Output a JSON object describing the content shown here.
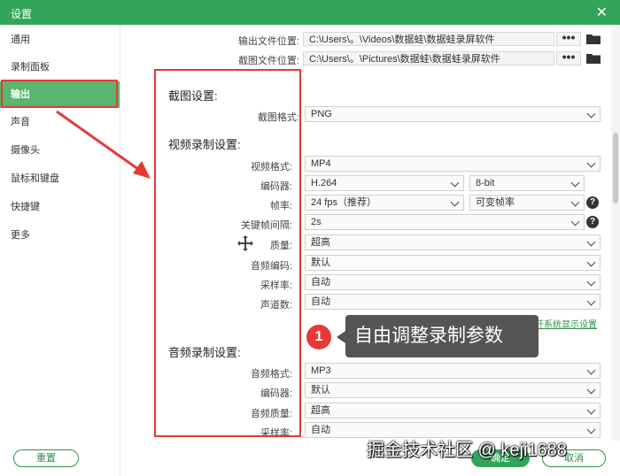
{
  "window": {
    "title": "设置"
  },
  "sidebar": {
    "items": [
      {
        "label": "通用"
      },
      {
        "label": "录制面板"
      },
      {
        "label": "输出"
      },
      {
        "label": "声音"
      },
      {
        "label": "摄像头"
      },
      {
        "label": "鼠标和键盘"
      },
      {
        "label": "快捷键"
      },
      {
        "label": "更多"
      }
    ],
    "active_index": 2
  },
  "output": {
    "file_location_label": "输出文件位置:",
    "file_location_value": "C:\\Users\\。\\Videos\\数据蛙\\数据蛙录屏软件",
    "screenshot_location_label": "截图文件位置:",
    "screenshot_location_value": "C:\\Users\\。\\Pictures\\数据蛙\\数据蛙录屏软件",
    "dots": "•••"
  },
  "screenshot_settings": {
    "title": "截图设置:",
    "format_label": "截图格式:",
    "format_value": "PNG"
  },
  "video_settings": {
    "title": "视频录制设置:",
    "format_label": "视频格式:",
    "format_value": "MP4",
    "encoder_label": "编码器:",
    "encoder_value": "H.264",
    "bitdepth_value": "8-bit",
    "framerate_label": "帧率:",
    "framerate_value": "24 fps（推荐）",
    "framerate_mode_value": "可变帧率",
    "keyframe_label": "关键帧间隔:",
    "keyframe_value": "2s",
    "quality_label": "质量:",
    "quality_value": "超高",
    "audio_codec_label": "音频编码:",
    "audio_codec_value": "默认",
    "samplerate_label": "采样率:",
    "samplerate_value": "自动",
    "channels_label": "声道数:",
    "channels_value": "自动",
    "display_settings_link": "打开系统显示设置"
  },
  "audio_settings": {
    "title": "音频录制设置:",
    "format_label": "音频格式:",
    "format_value": "MP3",
    "encoder_label": "编码器:",
    "encoder_value": "默认",
    "quality_label": "音频质量:",
    "quality_value": "超高",
    "samplerate_label": "采样率:",
    "samplerate_value": "自动"
  },
  "annotation": {
    "number": "1",
    "text": "自由调整录制参数"
  },
  "buttons": {
    "reset": "重置",
    "ok": "确定",
    "cancel": "取消"
  },
  "help": "?",
  "watermark": "掘金技术社区 @ keji1688",
  "colors": {
    "brand_green": "#33a55a",
    "highlight_red": "#e53935"
  }
}
